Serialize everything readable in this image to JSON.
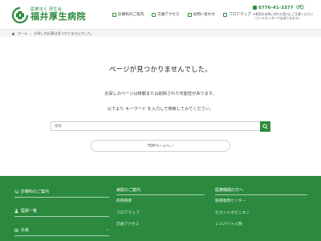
{
  "header": {
    "corp": "医療法人 厚生会",
    "name": "福井厚生病院",
    "nav": [
      "診療科のご案内",
      "交通アクセス",
      "お問い合わせ",
      "フロアマップ"
    ],
    "phone": "0776-41-3377（代）",
    "phone_note_1": "※専用のお問い合わせ窓口にご注意ください",
    "phone_note_2": "（コールセンターではありません）"
  },
  "breadcrumb": {
    "home": "ホーム",
    "current": "お探しの記事は見つかりませんでした。"
  },
  "main": {
    "title": "ページが見つかりませんでした。",
    "message_1": "お探しのページは移動または削除された可能性があります。",
    "message_2": "以下より キーワード を入力して検索してみてください。",
    "search_placeholder": "検索",
    "top_button": "TOPページへ"
  },
  "footer": {
    "col1": {
      "link_1": "診療科のご案内",
      "link_2": "医師一覧",
      "link_3": "外来"
    },
    "col2": {
      "heading": "病院のご案内",
      "items": [
        "病院概要",
        "フロアマップ",
        "交通アクセス"
      ]
    },
    "col3": {
      "heading": "医療機関の方へ",
      "items": [
        "医療連携センター",
        "セカンドオピニオン",
        "レスパイト入院"
      ]
    }
  },
  "colors": {
    "brand_green": "#2e8b3d",
    "footer_green": "#2b8a3e"
  },
  "icons": {
    "logo": "hospital-cross-logo",
    "nav": [
      "stethoscope-icon",
      "car-icon",
      "mail-icon",
      "map-icon"
    ],
    "search": "search-icon",
    "home": "home-icon"
  }
}
